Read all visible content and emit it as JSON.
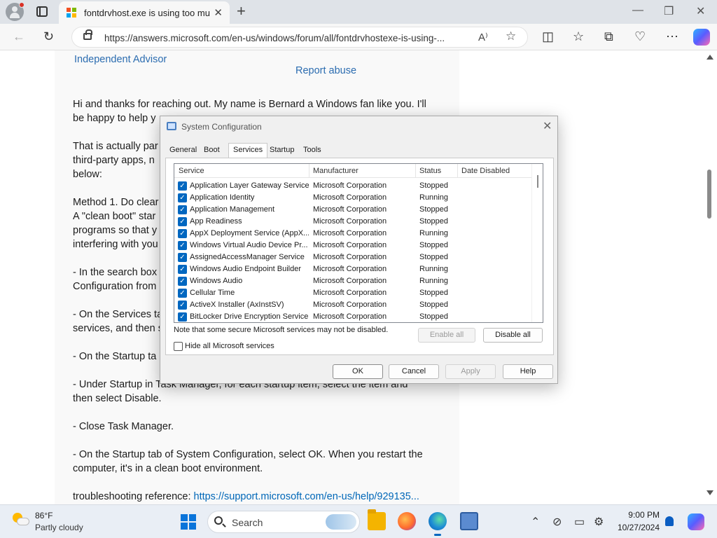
{
  "browser": {
    "tab_title": "fontdrvhost.exe is using too much",
    "url": "https://answers.microsoft.com/en-us/windows/forum/all/fontdrvhostexe-is-using-..."
  },
  "article": {
    "advisor": "Independent Advisor",
    "report": "Report abuse",
    "lines": [
      "Hi and thanks for reaching out. My name is Bernard a Windows fan like you. I'll",
      "be happy to help y",
      "That is actually par",
      "third-party apps, n",
      "below:",
      "Method 1. Do clear",
      "A \"clean boot\" star",
      "programs so that y",
      "interfering with you",
      "- In the search box",
      "Configuration from",
      "- On the Services ta",
      "services, and then s",
      "- On the Startup ta",
      "- Under Startup in Task Manager, for each startup item, select the item and",
      "then select Disable.",
      "- Close Task Manager.",
      "- On the Startup tab of System Configuration, select OK. When you restart the",
      "computer, it's in a clean boot environment."
    ],
    "ref_label": "troubleshooting reference: ",
    "ref_link": "https://support.microsoft.com/en-us/help/929135..."
  },
  "dialog": {
    "title": "System Configuration",
    "tabs": [
      "General",
      "Boot",
      "Services",
      "Startup",
      "Tools"
    ],
    "active_tab": "Services",
    "columns": [
      "Service",
      "Manufacturer",
      "Status",
      "Date Disabled"
    ],
    "rows": [
      {
        "service": "Application Layer Gateway Service",
        "manufacturer": "Microsoft Corporation",
        "status": "Stopped"
      },
      {
        "service": "Application Identity",
        "manufacturer": "Microsoft Corporation",
        "status": "Running"
      },
      {
        "service": "Application Management",
        "manufacturer": "Microsoft Corporation",
        "status": "Stopped"
      },
      {
        "service": "App Readiness",
        "manufacturer": "Microsoft Corporation",
        "status": "Stopped"
      },
      {
        "service": "AppX Deployment Service (AppX...",
        "manufacturer": "Microsoft Corporation",
        "status": "Running"
      },
      {
        "service": "Windows Virtual Audio Device Pr...",
        "manufacturer": "Microsoft Corporation",
        "status": "Stopped"
      },
      {
        "service": "AssignedAccessManager Service",
        "manufacturer": "Microsoft Corporation",
        "status": "Stopped"
      },
      {
        "service": "Windows Audio Endpoint Builder",
        "manufacturer": "Microsoft Corporation",
        "status": "Running"
      },
      {
        "service": "Windows Audio",
        "manufacturer": "Microsoft Corporation",
        "status": "Running"
      },
      {
        "service": "Cellular Time",
        "manufacturer": "Microsoft Corporation",
        "status": "Stopped"
      },
      {
        "service": "ActiveX Installer (AxInstSV)",
        "manufacturer": "Microsoft Corporation",
        "status": "Stopped"
      },
      {
        "service": "BitLocker Drive Encryption Service",
        "manufacturer": "Microsoft Corporation",
        "status": "Stopped"
      }
    ],
    "note": "Note that some secure Microsoft services may not be disabled.",
    "enable_all": "Enable all",
    "disable_all": "Disable all",
    "hide_ms": "Hide all Microsoft services",
    "ok": "OK",
    "cancel": "Cancel",
    "apply": "Apply",
    "help": "Help"
  },
  "taskbar": {
    "temperature": "86°F",
    "condition": "Partly cloudy",
    "search": "Search",
    "time": "9:00 PM",
    "date": "10/27/2024"
  },
  "icons": {
    "accent": "#0067c0",
    "link": "#2b6cb0"
  }
}
